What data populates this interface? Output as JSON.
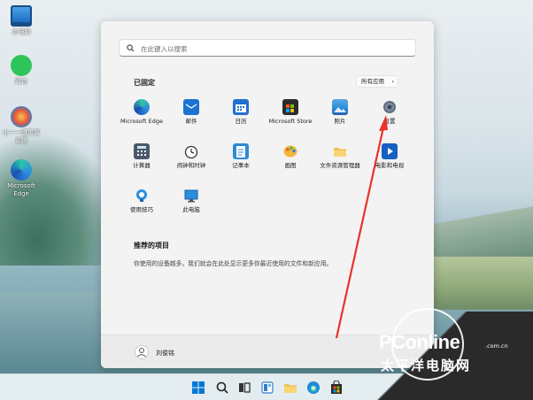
{
  "desktop": {
    "icons": [
      {
        "label": "此电脑",
        "icon": "computer-icon"
      },
      {
        "label": "微信",
        "icon": "wechat-icon"
      },
      {
        "label": "小一一键重装系统",
        "icon": "installer-icon"
      },
      {
        "label": "Microsoft Edge",
        "icon": "edge-icon"
      }
    ]
  },
  "start_menu": {
    "search_placeholder": "在此键入以搜索",
    "pinned_title": "已固定",
    "all_apps_label": "所有应用",
    "all_apps_chevron": "›",
    "pinned_apps": [
      {
        "label": "Microsoft Edge",
        "icon": "edge-icon",
        "color": "#1f8ad8"
      },
      {
        "label": "邮件",
        "icon": "mail-icon",
        "color": "#1c74d2"
      },
      {
        "label": "日历",
        "icon": "calendar-icon",
        "color": "#1f6fd0"
      },
      {
        "label": "Microsoft Store",
        "icon": "store-icon",
        "color": "#2b2b2b"
      },
      {
        "label": "照片",
        "icon": "photos-icon",
        "color": "#2a8bd7"
      },
      {
        "label": "设置",
        "icon": "settings-gear-icon",
        "color": "#6b7b8c"
      },
      {
        "label": "计算器",
        "icon": "calculator-icon",
        "color": "#4a5a6a"
      },
      {
        "label": "闹钟和时钟",
        "icon": "clock-icon",
        "color": "#555555"
      },
      {
        "label": "记事本",
        "icon": "notepad-icon",
        "color": "#2f8ad4"
      },
      {
        "label": "画图",
        "icon": "paint-icon",
        "color": "#e0a21c"
      },
      {
        "label": "文件资源管理器",
        "icon": "folder-icon",
        "color": "#f2c14e"
      },
      {
        "label": "电影和电视",
        "icon": "movies-icon",
        "color": "#1560c0"
      },
      {
        "label": "使用技巧",
        "icon": "tips-icon",
        "color": "#2b8fe0"
      },
      {
        "label": "此电脑",
        "icon": "computer-icon",
        "color": "#2a8fde"
      }
    ],
    "recommended_title": "推荐的项目",
    "recommended_desc": "你使用的设备越多，我们就会在此处显示更多你最近使用的文件和新应用。",
    "user_name": "刘俊铭"
  },
  "taskbar": {
    "items": [
      {
        "icon": "windows-start-icon"
      },
      {
        "icon": "search-icon"
      },
      {
        "icon": "task-view-icon"
      },
      {
        "icon": "widgets-icon"
      },
      {
        "icon": "file-explorer-icon"
      },
      {
        "icon": "edge-icon"
      },
      {
        "icon": "store-icon"
      }
    ]
  },
  "watermark": {
    "logo": "PConline",
    "domain": ".com.cn",
    "subtitle": "太平洋电脑网"
  },
  "colors": {
    "annotation_arrow": "#e8322a",
    "windows_blue": "#0078d4"
  }
}
